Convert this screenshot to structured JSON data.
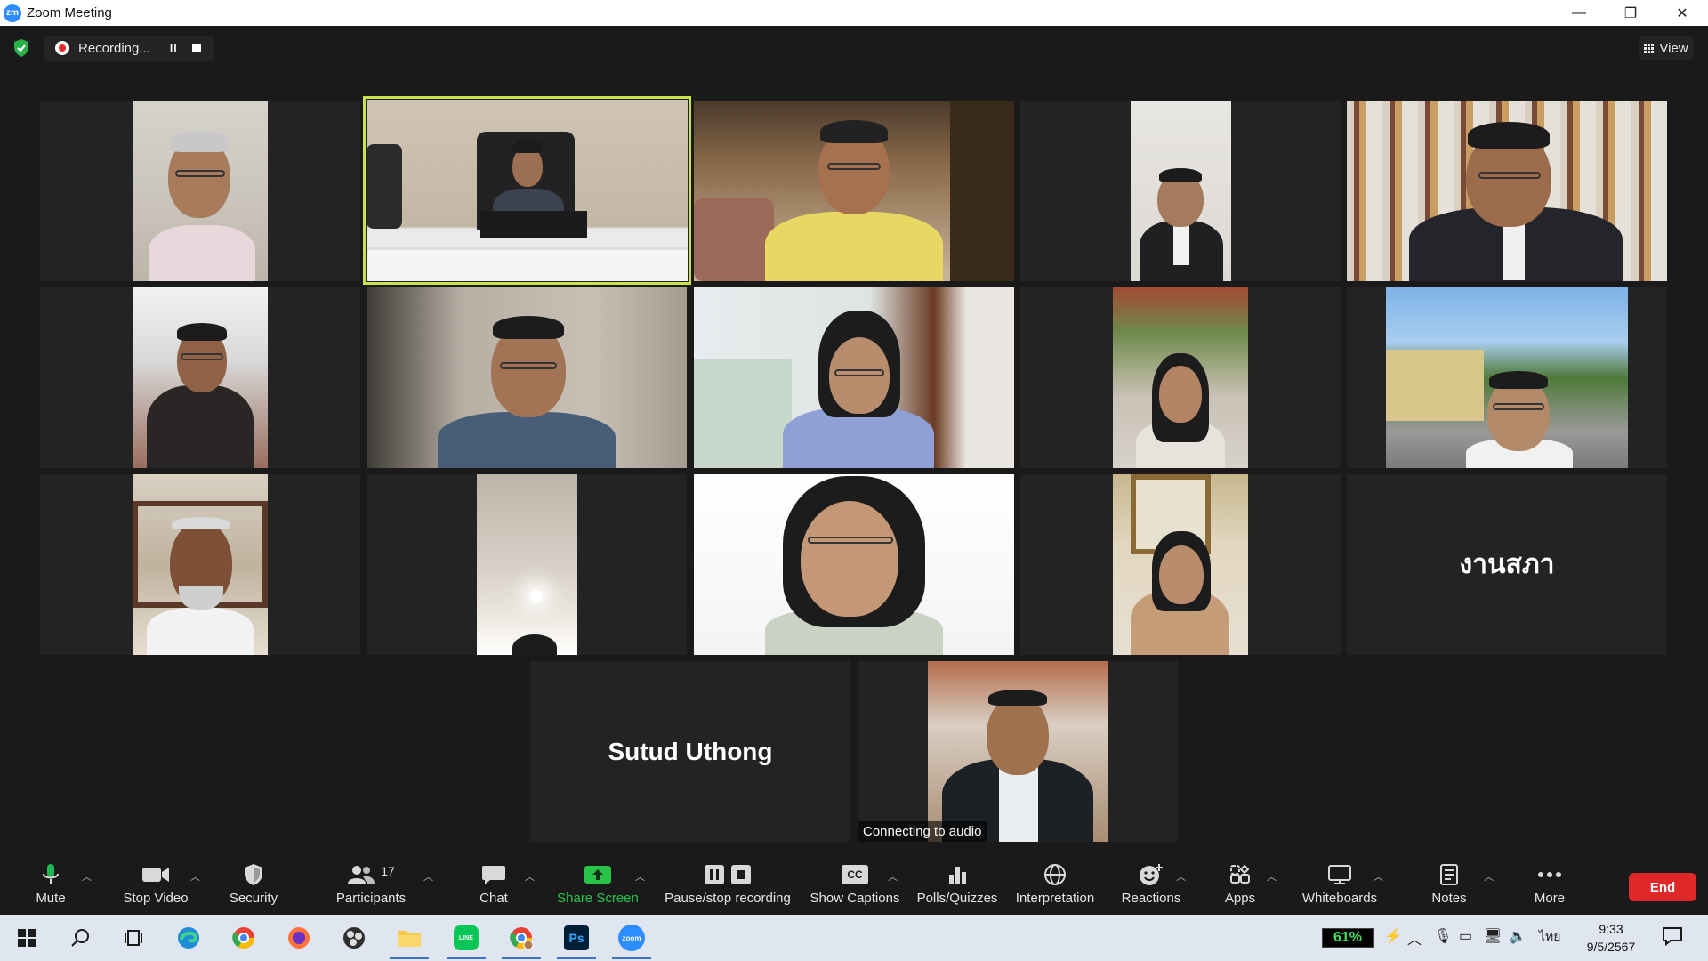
{
  "window": {
    "app_icon_text": "zm",
    "title": "Zoom Meeting",
    "minimize_glyph": "—",
    "restore_glyph": "❐",
    "close_glyph": "✕"
  },
  "topbar": {
    "security_icon": "shield-check-icon",
    "recording_text": "Recording...",
    "pause_glyph": "II",
    "view_label": "View"
  },
  "tiles": {
    "sutud_name": "Sutud Uthong",
    "ngan_sapha_name": "งานสภา",
    "connecting_caption": "Connecting to audio"
  },
  "toolbar": {
    "mute": "Mute",
    "stop_video": "Stop Video",
    "security": "Security",
    "participants": "Participants",
    "participants_count": "17",
    "chat": "Chat",
    "share_screen": "Share Screen",
    "pause_stop_recording": "Pause/stop recording",
    "show_captions": "Show Captions",
    "cc_glyph": "CC",
    "polls": "Polls/Quizzes",
    "interpretation": "Interpretation",
    "reactions": "Reactions",
    "apps": "Apps",
    "whiteboards": "Whiteboards",
    "notes": "Notes",
    "more": "More",
    "end": "End"
  },
  "taskbar": {
    "battery_percent": "61%",
    "language": "ไทย",
    "time": "9:33",
    "date": "9/5/2567",
    "zoom_badge": "zoom",
    "ps_badge": "Ps",
    "line_badge": "LINE"
  },
  "colors": {
    "active_speaker_border": "#c9e34a",
    "end_button": "#e02828",
    "share_green": "#27c449",
    "zoom_blue": "#2d8cff"
  }
}
